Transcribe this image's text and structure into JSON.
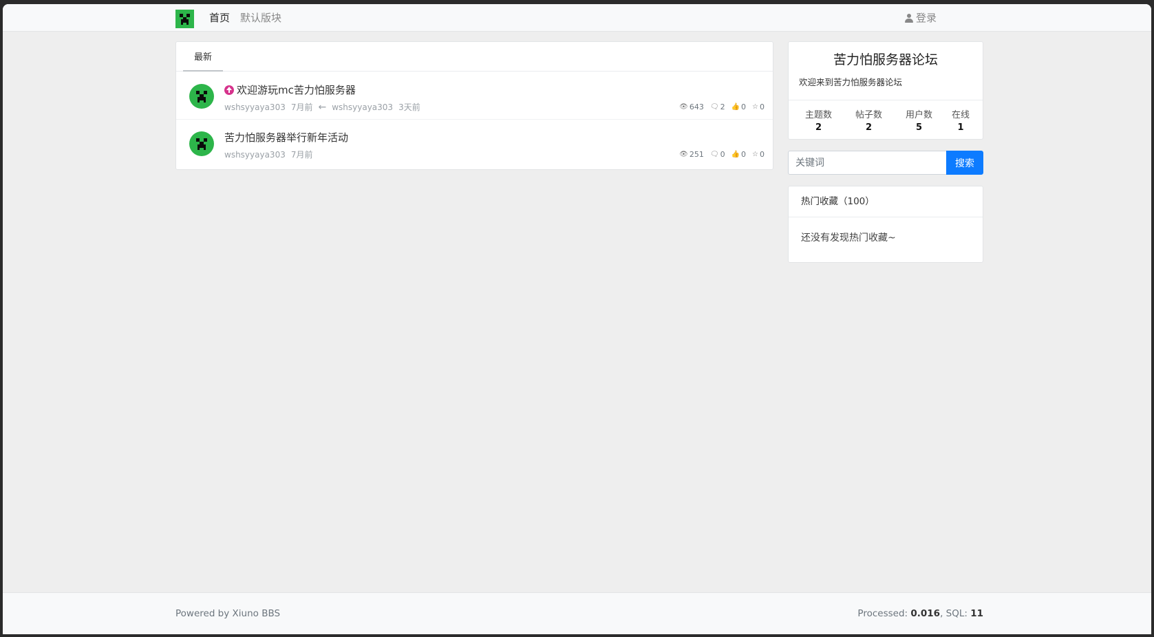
{
  "navbar": {
    "logo_icon": "creeper-icon",
    "links": [
      {
        "label": "首页",
        "active": true
      },
      {
        "label": "默认版块",
        "active": false
      }
    ],
    "login_label": "登录"
  },
  "threads": {
    "tab_label": "最新",
    "items": [
      {
        "title": "欢迎游玩mc苦力怕服务器",
        "pinned": true,
        "author": "wshsyyaya303",
        "created": "7月前",
        "last_reply_user": "wshsyyaya303",
        "last_reply_time": "3天前",
        "views": "643",
        "replies": "2",
        "likes": "0",
        "favorites": "0"
      },
      {
        "title": "苦力怕服务器举行新年活动",
        "pinned": false,
        "author": "wshsyyaya303",
        "created": "7月前",
        "views": "251",
        "replies": "0",
        "likes": "0",
        "favorites": "0"
      }
    ]
  },
  "sidebar": {
    "forum_title": "苦力怕服务器论坛",
    "forum_desc": "欢迎来到苦力怕服务器论坛",
    "stats": [
      {
        "label": "主题数",
        "value": "2"
      },
      {
        "label": "帖子数",
        "value": "2"
      },
      {
        "label": "用户数",
        "value": "5"
      },
      {
        "label": "在线",
        "value": "1"
      }
    ],
    "search_placeholder": "关键词",
    "search_button": "搜索",
    "favorites_title": "热门收藏（100）",
    "favorites_empty": "还没有发现热门收藏~"
  },
  "footer": {
    "powered_by": "Powered by Xiuno BBS",
    "processed_label": "Processed: ",
    "processed_value": "0.016",
    "sql_label": ", SQL: ",
    "sql_value": "11"
  },
  "colors": {
    "primary": "#0d7bff",
    "avatar_green": "#2db54a",
    "pin_pink": "#d6338c"
  }
}
